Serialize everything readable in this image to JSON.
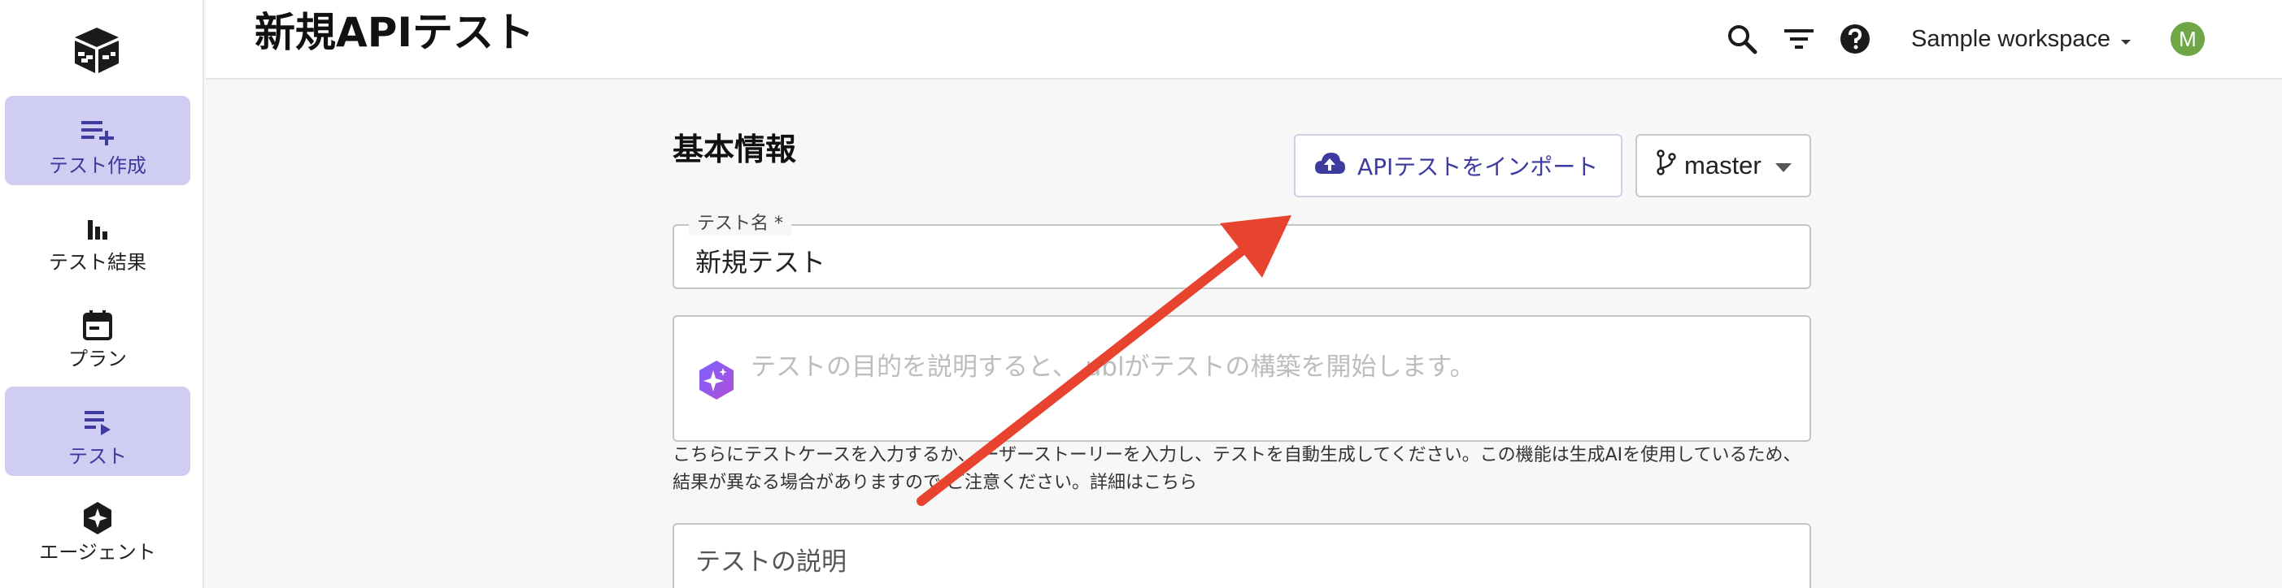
{
  "sidebar": {
    "items": [
      {
        "label": "テスト作成",
        "icon": "list-add-icon",
        "active": true
      },
      {
        "label": "テスト結果",
        "icon": "bar-chart-icon",
        "active": false
      },
      {
        "label": "プラン",
        "icon": "calendar-icon",
        "active": false
      },
      {
        "label": "テスト",
        "icon": "list-play-icon",
        "active": true
      },
      {
        "label": "エージェント",
        "icon": "sparkle-badge-icon",
        "active": false
      }
    ]
  },
  "header": {
    "title": "新規APIテスト",
    "workspace": "Sample workspace",
    "avatar_initial": "M"
  },
  "main": {
    "section_title": "基本情報",
    "import_button": "APIテストをインポート",
    "branch": "master",
    "name_field": {
      "label": "テスト名 *",
      "value": "新規テスト"
    },
    "ai_field": {
      "placeholder": "テストの目的を説明すると、 ublがテストの構築を開始します。"
    },
    "help_text_line1": "こちらにテストケースを入力するか、 ーザーストーリーを入力し、テストを自動生成してください。この機能は生成AIを使用しているため、",
    "help_text_line2": "結果が異なる場合がありますので ご注意ください。詳細はこちら",
    "description_field": {
      "placeholder": "テストの説明"
    }
  },
  "colors": {
    "accent": "#3d3aa0",
    "active_nav_bg": "#cfcdf1",
    "annotation_arrow": "#e8432e",
    "avatar_bg": "#6fa646"
  }
}
